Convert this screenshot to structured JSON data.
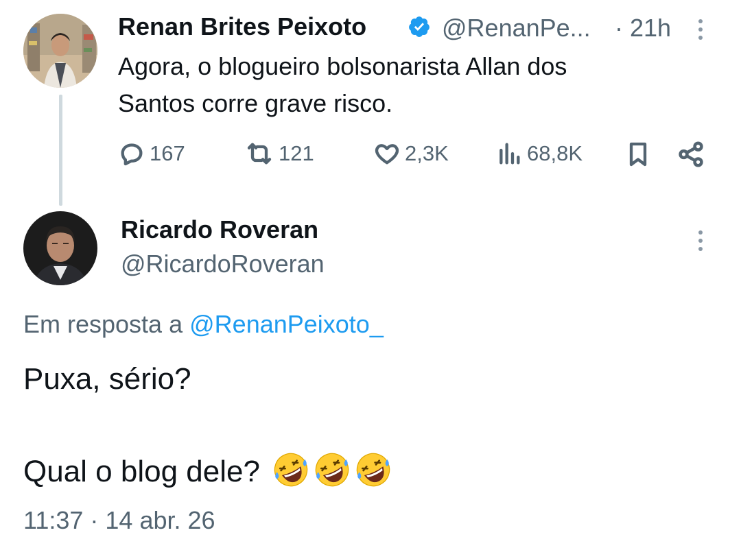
{
  "parent_tweet": {
    "author_name": "Renan Brites Peixoto",
    "author_handle": "@RenanPe...",
    "time_sep": "·",
    "time": "21h",
    "text_line1": "Agora, o blogueiro bolsonarista Allan dos",
    "text_line2": "Santos corre grave risco.",
    "metrics": {
      "replies": "167",
      "reposts": "121",
      "likes": "2,3K",
      "views": "68,8K"
    }
  },
  "reply_tweet": {
    "author_name": "Ricardo Roveran",
    "author_handle": "@RicardoRoveran",
    "reply_prefix": "Em resposta a",
    "reply_mention": "@RenanPeixoto_",
    "text_line1": "Puxa, sério?",
    "text_line2": "Qual o blog dele?",
    "emoji_count": 3,
    "timestamp": "11:37 · 14 abr. 26"
  },
  "colors": {
    "verified": "#1d9bf0",
    "mention": "#1d9bf0",
    "secondary_text": "#536471",
    "thread_line": "#cfd9de"
  },
  "icons": [
    "verified-badge-icon",
    "more-options-icon",
    "reply-icon",
    "repost-icon",
    "like-icon",
    "views-icon",
    "bookmark-icon",
    "share-icon",
    "rolling-laughing-emoji"
  ]
}
